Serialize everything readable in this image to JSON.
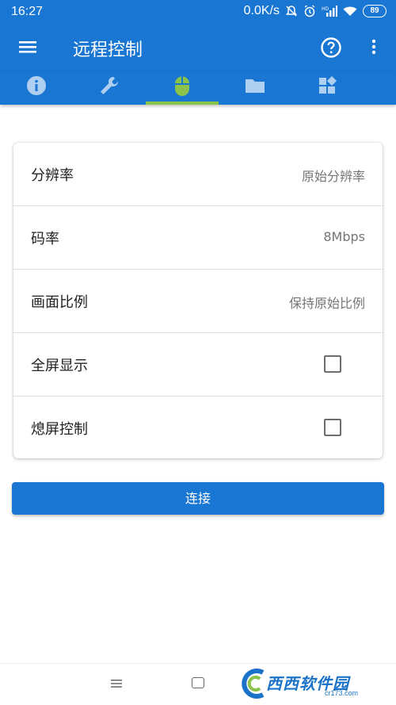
{
  "status_bar": {
    "time": "16:27",
    "network_speed": "0.0K/s",
    "battery": "89"
  },
  "app_bar": {
    "title": "远程控制",
    "menu_icon": "hamburger-menu-icon",
    "help_icon": "help-circle-icon",
    "more_icon": "more-vert-icon"
  },
  "tabs": {
    "items": [
      {
        "icon": "info-icon"
      },
      {
        "icon": "wrench-icon"
      },
      {
        "icon": "mouse-icon",
        "selected": true
      },
      {
        "icon": "folder-icon"
      },
      {
        "icon": "widgets-icon"
      },
      {
        "icon": "partial-icon"
      }
    ],
    "indicator_color": "#8bc34a"
  },
  "settings": {
    "resolution_label": "分辨率",
    "resolution_value": "原始分辨率",
    "bitrate_label": "码率",
    "bitrate_value": "8Mbps",
    "scale_label": "画面比例",
    "scale_value": "保持原始比例",
    "fullscreen_label": "全屏显示",
    "fullscreen_checked": false,
    "screen_off_label": "熄屏控制",
    "screen_off_checked": false
  },
  "connect_button_label": "连接",
  "watermark": {
    "text": "西西软件园",
    "url": "cr173.com"
  },
  "colors": {
    "primary": "#1976d2",
    "accent": "#8bc34a"
  }
}
